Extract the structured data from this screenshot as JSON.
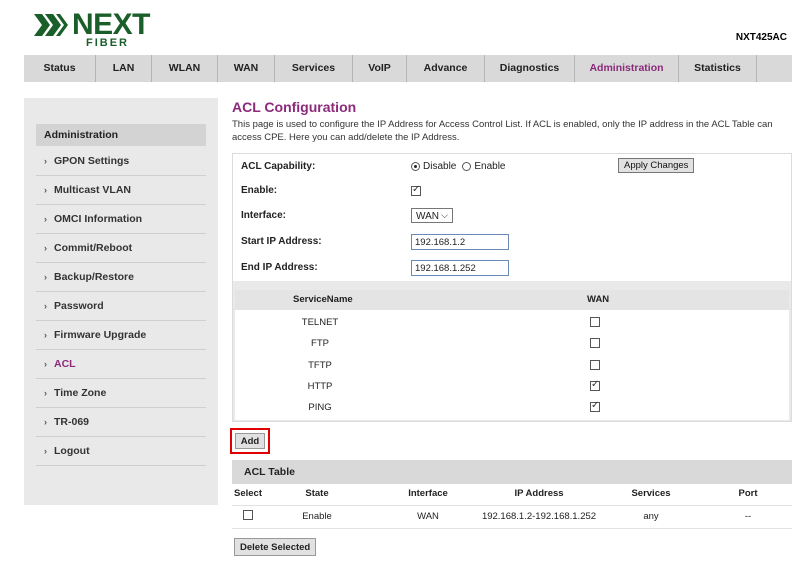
{
  "header": {
    "logo_text": "NEXT",
    "logo_sub": "FIBER",
    "model": "NXT425AC"
  },
  "nav": [
    {
      "label": "Status"
    },
    {
      "label": "LAN"
    },
    {
      "label": "WLAN"
    },
    {
      "label": "WAN"
    },
    {
      "label": "Services"
    },
    {
      "label": "VoIP"
    },
    {
      "label": "Advance"
    },
    {
      "label": "Diagnostics"
    },
    {
      "label": "Administration",
      "active": true
    },
    {
      "label": "Statistics"
    }
  ],
  "sidebar": {
    "heading": "Administration",
    "items": [
      {
        "label": "GPON Settings"
      },
      {
        "label": "Multicast VLAN"
      },
      {
        "label": "OMCI Information"
      },
      {
        "label": "Commit/Reboot"
      },
      {
        "label": "Backup/Restore"
      },
      {
        "label": "Password"
      },
      {
        "label": "Firmware Upgrade"
      },
      {
        "label": "ACL",
        "active": true
      },
      {
        "label": "Time Zone"
      },
      {
        "label": "TR-069"
      },
      {
        "label": "Logout"
      }
    ]
  },
  "main": {
    "title": "ACL Configuration",
    "description": "This page is used to configure the IP Address for Access Control List. If ACL is enabled, only the IP address in the ACL Table can access CPE. Here you can add/delete the IP Address.",
    "acl_capability": {
      "label": "ACL Capability:",
      "option_disable": "Disable",
      "option_enable": "Enable",
      "selected": "Disable",
      "apply_label": "Apply Changes"
    },
    "enable": {
      "label": "Enable:",
      "checked": true
    },
    "interface": {
      "label": "Interface:",
      "value": "WAN"
    },
    "start_ip": {
      "label": "Start IP Address:",
      "value": "192.168.1.2"
    },
    "end_ip": {
      "label": "End IP Address:",
      "value": "192.168.1.252"
    },
    "services": {
      "col_name": "ServiceName",
      "col_wan": "WAN",
      "rows": [
        {
          "name": "TELNET",
          "wan": false
        },
        {
          "name": "FTP",
          "wan": false
        },
        {
          "name": "TFTP",
          "wan": false
        },
        {
          "name": "HTTP",
          "wan": true
        },
        {
          "name": "PING",
          "wan": true
        }
      ]
    },
    "add_label": "Add",
    "acl_table": {
      "title": "ACL Table",
      "columns": [
        "Select",
        "State",
        "Interface",
        "IP Address",
        "Services",
        "Port"
      ],
      "rows": [
        {
          "state": "Enable",
          "interface": "WAN",
          "ip": "192.168.1.2-192.168.1.252",
          "services": "any",
          "port": "--"
        }
      ]
    },
    "delete_label": "Delete Selected"
  }
}
